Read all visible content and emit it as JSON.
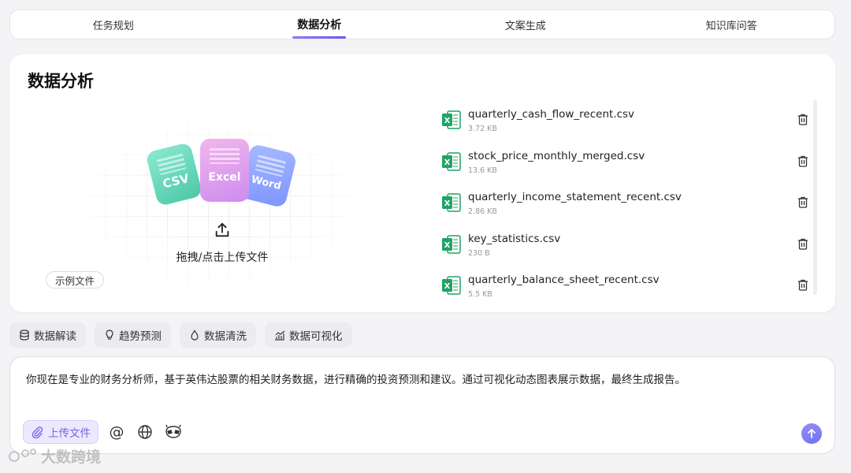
{
  "tabs": [
    {
      "label": "任务规划"
    },
    {
      "label": "数据分析"
    },
    {
      "label": "文案生成"
    },
    {
      "label": "知识库问答"
    }
  ],
  "active_tab": "数据分析",
  "card": {
    "title": "数据分析",
    "upload": {
      "art_labels": {
        "csv": "CSV",
        "excel": "Excel",
        "word": "Word"
      },
      "text": "拖拽/点击上传文件"
    },
    "sample_button": "示例文件"
  },
  "files": [
    {
      "name": "quarterly_cash_flow_recent.csv",
      "size": "3.72 KB"
    },
    {
      "name": "stock_price_monthly_merged.csv",
      "size": "13.6 KB"
    },
    {
      "name": "quarterly_income_statement_recent.csv",
      "size": "2.86 KB"
    },
    {
      "name": "key_statistics.csv",
      "size": "230 B"
    },
    {
      "name": "quarterly_balance_sheet_recent.csv",
      "size": "5.5 KB"
    }
  ],
  "tools": [
    {
      "label": "数据解读",
      "icon": "database-icon"
    },
    {
      "label": "趋势预测",
      "icon": "lightbulb-icon"
    },
    {
      "label": "数据清洗",
      "icon": "droplet-icon"
    },
    {
      "label": "数据可视化",
      "icon": "chart-icon"
    }
  ],
  "input": {
    "prompt": "你现在是专业的财务分析师，基于英伟达股票的相关财务数据，进行精确的投资预测和建议。通过可视化动态图表展示数据，最终生成报告。",
    "upload_button": "上传文件",
    "at_symbol": "@"
  },
  "watermark": "大数跨境",
  "colors": {
    "accent": "#7b62e6",
    "excel_green": "#21a366"
  }
}
